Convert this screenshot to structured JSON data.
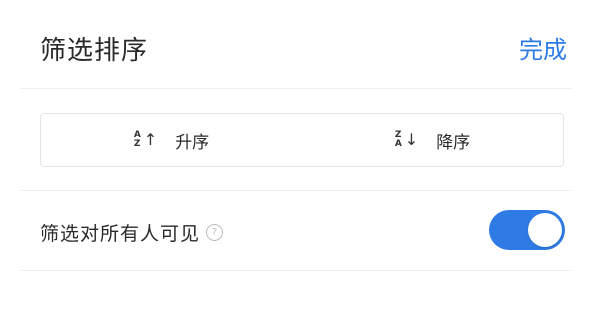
{
  "header": {
    "title": "筛选排序",
    "done_label": "完成"
  },
  "sort": {
    "ascending": {
      "icon": "sort-ascending-icon",
      "glyph_top": "A",
      "glyph_bottom": "Z",
      "arrow": "↑",
      "label": "升序"
    },
    "descending": {
      "icon": "sort-descending-icon",
      "glyph_top": "Z",
      "glyph_bottom": "A",
      "arrow": "↓",
      "label": "降序"
    }
  },
  "visibility": {
    "label": "筛选对所有人可见",
    "help_icon": "help-circle-icon",
    "help_glyph": "?",
    "toggle_on": true
  },
  "colors": {
    "accent": "#2f7be5",
    "divider": "#eeeeee"
  }
}
